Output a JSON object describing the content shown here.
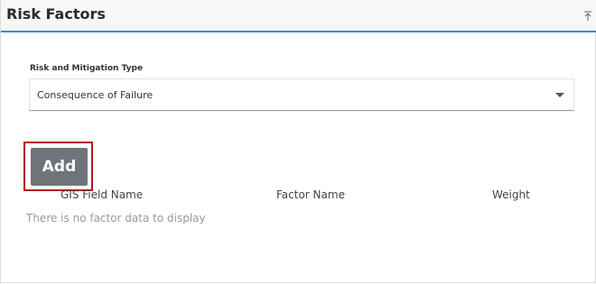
{
  "header": {
    "title": "Risk Factors",
    "collapse_icon": "collapse-up-icon"
  },
  "form": {
    "type_label": "Risk and Mitigation Type",
    "type_value": "Consequence of Failure"
  },
  "actions": {
    "add_label": "Add"
  },
  "table": {
    "columns": [
      "GIS Field Name",
      "Factor Name",
      "Weight"
    ],
    "empty_message": "There is no factor data to display"
  },
  "colors": {
    "accent": "#2f8fd6",
    "button": "#6f747a",
    "highlight": "#b01b1b"
  }
}
